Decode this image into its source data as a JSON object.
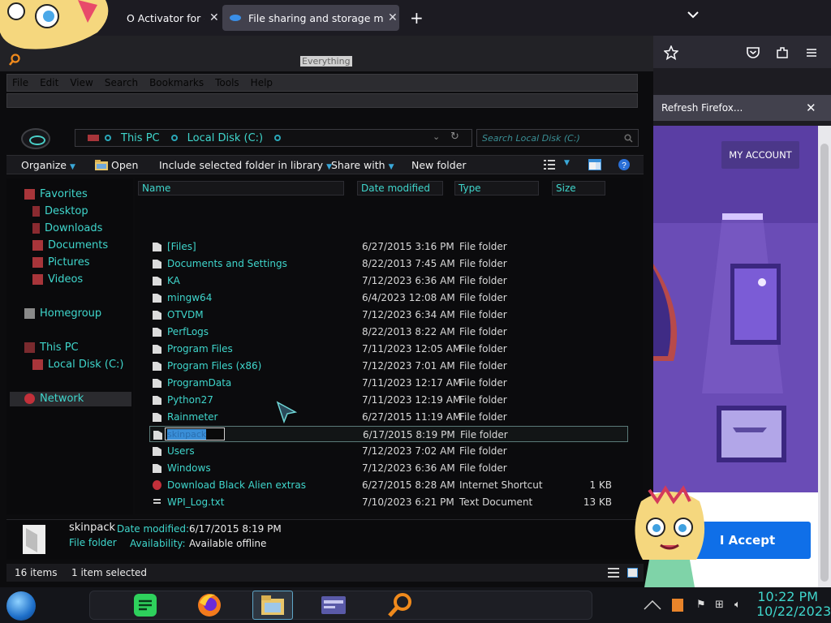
{
  "browser": {
    "tabs": [
      {
        "label": "O Activator for offi",
        "active": false
      },
      {
        "label": "File sharing and storage made s",
        "active": true
      }
    ],
    "new_tab": "+",
    "notice": "Refresh Firefox...",
    "page": {
      "my_account": "MY ACCOUNT",
      "accept": "I Accept"
    }
  },
  "explorer": {
    "everything_label": "Everything",
    "menu": [
      "File",
      "Edit",
      "View",
      "Search",
      "Bookmarks",
      "Tools",
      "Help"
    ],
    "address": {
      "this_pc": "This PC",
      "local_disk": "Local Disk (C:)"
    },
    "search_placeholder": "Search Local Disk (C:)",
    "commands": {
      "organize": "Organize",
      "open": "Open",
      "include": "Include selected folder in library",
      "share": "Share with",
      "new_folder": "New folder"
    },
    "nav": {
      "favorites": "Favorites",
      "desktop": "Desktop",
      "downloads": "Downloads",
      "documents": "Documents",
      "pictures": "Pictures",
      "videos": "Videos",
      "homegroup": "Homegroup",
      "this_pc": "This PC",
      "local_disk": "Local Disk (C:)",
      "network": "Network"
    },
    "columns": {
      "name": "Name",
      "date": "Date modified",
      "type": "Type",
      "size": "Size"
    },
    "rows": [
      {
        "name": "[Files]",
        "date": "6/27/2015 3:16 PM",
        "type": "File folder",
        "size": ""
      },
      {
        "name": "Documents and Settings",
        "date": "8/22/2013 7:45 AM",
        "type": "File folder",
        "size": ""
      },
      {
        "name": "KA",
        "date": "7/12/2023 6:36 AM",
        "type": "File folder",
        "size": ""
      },
      {
        "name": "mingw64",
        "date": "6/4/2023 12:08 AM",
        "type": "File folder",
        "size": ""
      },
      {
        "name": "OTVDM",
        "date": "7/12/2023 6:34 AM",
        "type": "File folder",
        "size": ""
      },
      {
        "name": "PerfLogs",
        "date": "8/22/2013 8:22 AM",
        "type": "File folder",
        "size": ""
      },
      {
        "name": "Program Files",
        "date": "7/11/2023 12:05 AM",
        "type": "File folder",
        "size": ""
      },
      {
        "name": "Program Files (x86)",
        "date": "7/12/2023 7:01 AM",
        "type": "File folder",
        "size": ""
      },
      {
        "name": "ProgramData",
        "date": "7/11/2023 12:17 AM",
        "type": "File folder",
        "size": ""
      },
      {
        "name": "Python27",
        "date": "7/11/2023 12:19 AM",
        "type": "File folder",
        "size": ""
      },
      {
        "name": "Rainmeter",
        "date": "6/27/2015 11:19 AM",
        "type": "File folder",
        "size": ""
      },
      {
        "name": "skinpack",
        "date": "6/17/2015 8:19 PM",
        "type": "File folder",
        "size": ""
      },
      {
        "name": "Users",
        "date": "7/12/2023 7:02 AM",
        "type": "File folder",
        "size": ""
      },
      {
        "name": "Windows",
        "date": "7/12/2023 6:36 AM",
        "type": "File folder",
        "size": ""
      },
      {
        "name": "Download Black Alien extras",
        "date": "6/27/2015 8:28 AM",
        "type": "Internet Shortcut",
        "size": "1 KB"
      },
      {
        "name": "WPI_Log.txt",
        "date": "7/10/2023 6:21 PM",
        "type": "Text Document",
        "size": "13 KB"
      }
    ],
    "rename_value": "skinpack",
    "details": {
      "name": "skinpack",
      "type": "File folder",
      "date_label": "Date modified:",
      "date_value": "6/17/2015 8:19 PM",
      "avail_label": "Availability:",
      "avail_value": "Available offline"
    },
    "status": {
      "items": "16 items",
      "selected": "1 item selected"
    }
  },
  "taskbar": {
    "time": "10:22 PM",
    "date": "10/22/2023"
  },
  "colors": {
    "accent": "#3fd6cc",
    "firefox_page": "#6b4bb8",
    "accept_button": "#0f6fe8"
  }
}
